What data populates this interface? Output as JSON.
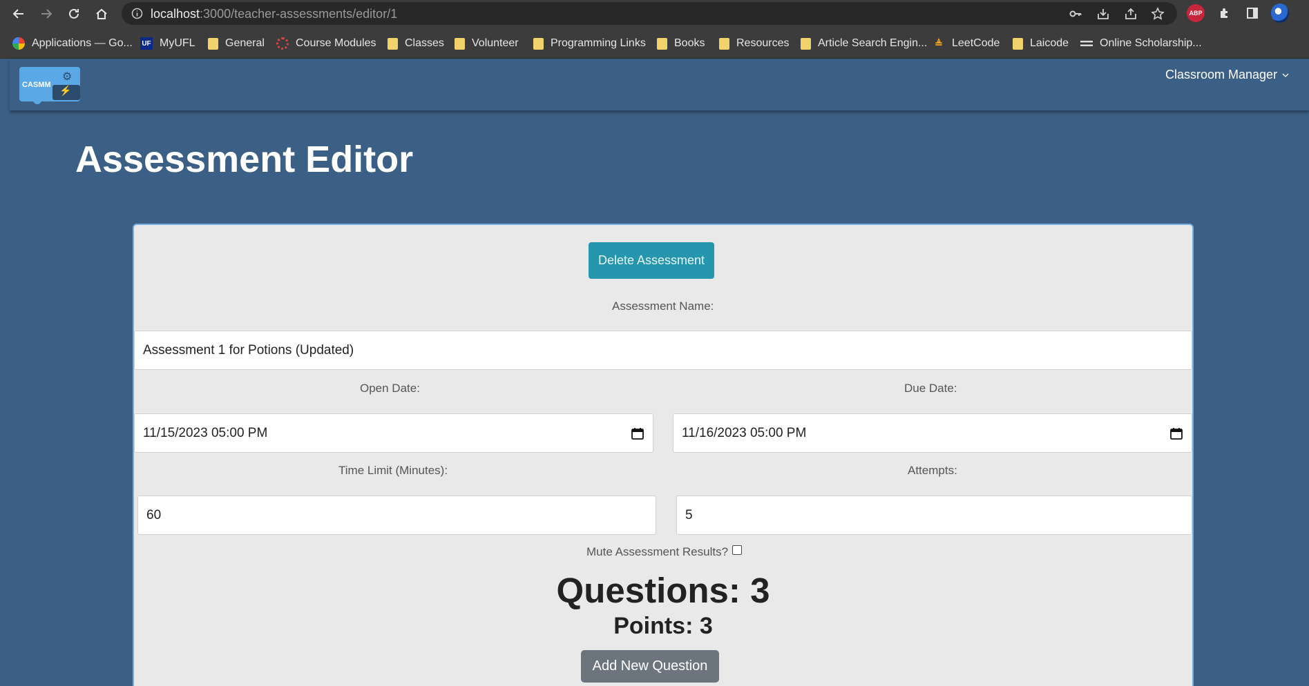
{
  "browser": {
    "url_host": "localhost",
    "url_path": ":3000/teacher-assessments/editor/1",
    "extension_abp": "ABP",
    "bookmarks": [
      {
        "label": "Applications — Go...",
        "icon": "google-icon"
      },
      {
        "label": "MyUFL",
        "icon": "uf-icon"
      },
      {
        "label": "General",
        "icon": "folder-icon"
      },
      {
        "label": "Course Modules",
        "icon": "canvas-icon"
      },
      {
        "label": "Classes",
        "icon": "folder-icon"
      },
      {
        "label": "Volunteer",
        "icon": "folder-icon"
      },
      {
        "label": "Programming Links",
        "icon": "folder-icon"
      },
      {
        "label": "Books",
        "icon": "folder-icon"
      },
      {
        "label": "Resources",
        "icon": "folder-icon"
      },
      {
        "label": "Article Search Engin...",
        "icon": "folder-icon"
      },
      {
        "label": "LeetCode",
        "icon": "leetcode-icon"
      },
      {
        "label": "Laicode",
        "icon": "folder-icon"
      },
      {
        "label": "Online Scholarship...",
        "icon": "site-icon"
      }
    ]
  },
  "navbar": {
    "logo_text": "CASMM",
    "menu_label": "Classroom Manager"
  },
  "page": {
    "title": "Assessment Editor"
  },
  "form": {
    "delete_button": "Delete Assessment",
    "name_label": "Assessment Name:",
    "name_value": "Assessment 1 for Potions (Updated)",
    "open_date_label": "Open Date:",
    "open_date_value": "11/15/2023 05:00  PM",
    "due_date_label": "Due Date:",
    "due_date_value": "11/16/2023 05:00  PM",
    "time_limit_label": "Time Limit (Minutes):",
    "time_limit_value": "60",
    "attempts_label": "Attempts:",
    "attempts_value": "5",
    "mute_label": "Mute Assessment Results?",
    "mute_checked": false,
    "questions_text": "Questions: 3",
    "points_text": "Points: 3",
    "add_question_button": "Add New Question"
  },
  "colors": {
    "page_background": "#3c5f85",
    "card_background": "#e9e9e9",
    "delete_button": "#2596ad",
    "add_button": "#6c757d"
  }
}
